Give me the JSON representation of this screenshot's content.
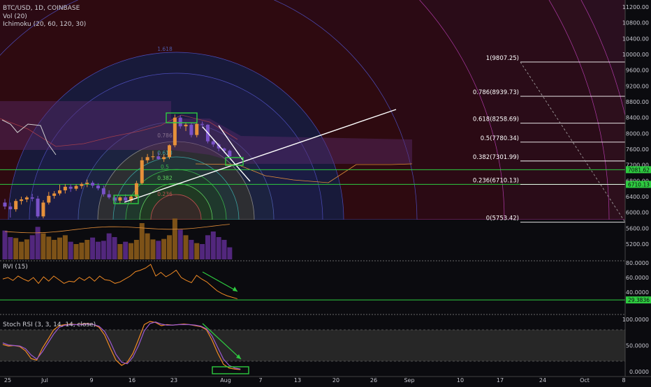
{
  "header": {
    "title": "BTC/USD, 1D, COINBASE",
    "vol_label": "Vol (20)",
    "ichimoku_label": "Ichimoku (20, 60, 120, 30)"
  },
  "panes": {
    "rvi_label": "RVI (15)",
    "stoch_label": "Stoch RSI (3, 3, 14, 14, close)"
  },
  "colors": {
    "background": "#0b0b0f",
    "bull_candle": "#e6903a",
    "bear_candle": "#7a52c8",
    "green_line": "#2ecc40",
    "white_line": "#ffffff",
    "rvi_line": "#f08a24",
    "stoch_k": "#f08a24",
    "stoch_d": "#9b59d0",
    "fib_fan_yellow": "#d7c84a",
    "fib_fan_outer": "#c94ccf"
  },
  "chart_data": [
    {
      "type": "candlestick",
      "title": "BTC/USD, 1D, COINBASE",
      "x_ticks": [
        "25",
        "Jul",
        "9",
        "16",
        "23",
        "Aug",
        "7",
        "13",
        "20",
        "26",
        "Sep",
        "10",
        "17",
        "24",
        "Oct",
        "8"
      ],
      "y_ticks": [
        "11200.00",
        "10800.00",
        "10400.00",
        "10000.00",
        "9600.00",
        "9200.00",
        "8800.00",
        "8400.00",
        "8000.00",
        "7600.00",
        "7200.00",
        "6800.00",
        "6400.00",
        "6000.00",
        "5600.00",
        "5200.00"
      ],
      "price_tags": [
        "7081.62",
        "6710.13"
      ],
      "candles": [
        {
          "o": 6250,
          "h": 6340,
          "l": 6080,
          "c": 6150
        },
        {
          "o": 6150,
          "h": 6250,
          "l": 5870,
          "c": 6080
        },
        {
          "o": 6080,
          "h": 6340,
          "l": 6020,
          "c": 6290
        },
        {
          "o": 6290,
          "h": 6400,
          "l": 6200,
          "c": 6330
        },
        {
          "o": 6330,
          "h": 6420,
          "l": 6260,
          "c": 6380
        },
        {
          "o": 6380,
          "h": 6470,
          "l": 6280,
          "c": 6350
        },
        {
          "o": 6350,
          "h": 6420,
          "l": 5860,
          "c": 5900
        },
        {
          "o": 5900,
          "h": 6310,
          "l": 5850,
          "c": 6250
        },
        {
          "o": 6250,
          "h": 6520,
          "l": 6200,
          "c": 6420
        },
        {
          "o": 6420,
          "h": 6540,
          "l": 6350,
          "c": 6480
        },
        {
          "o": 6480,
          "h": 6700,
          "l": 6430,
          "c": 6560
        },
        {
          "o": 6560,
          "h": 6720,
          "l": 6480,
          "c": 6650
        },
        {
          "o": 6650,
          "h": 6720,
          "l": 6520,
          "c": 6600
        },
        {
          "o": 6600,
          "h": 6710,
          "l": 6550,
          "c": 6670
        },
        {
          "o": 6670,
          "h": 6760,
          "l": 6600,
          "c": 6720
        },
        {
          "o": 6720,
          "h": 6830,
          "l": 6640,
          "c": 6750
        },
        {
          "o": 6750,
          "h": 6800,
          "l": 6620,
          "c": 6680
        },
        {
          "o": 6680,
          "h": 6740,
          "l": 6560,
          "c": 6610
        },
        {
          "o": 6610,
          "h": 6680,
          "l": 6400,
          "c": 6460
        },
        {
          "o": 6460,
          "h": 6560,
          "l": 6340,
          "c": 6380
        },
        {
          "o": 6380,
          "h": 6420,
          "l": 6250,
          "c": 6300
        },
        {
          "o": 6300,
          "h": 6410,
          "l": 6230,
          "c": 6380
        },
        {
          "o": 6380,
          "h": 6460,
          "l": 6250,
          "c": 6300
        },
        {
          "o": 6300,
          "h": 6450,
          "l": 6250,
          "c": 6400
        },
        {
          "o": 6400,
          "h": 6800,
          "l": 6350,
          "c": 6740
        },
        {
          "o": 6740,
          "h": 7400,
          "l": 6700,
          "c": 7320
        },
        {
          "o": 7320,
          "h": 7480,
          "l": 7250,
          "c": 7400
        },
        {
          "o": 7400,
          "h": 7560,
          "l": 7330,
          "c": 7420
        },
        {
          "o": 7420,
          "h": 7520,
          "l": 7330,
          "c": 7350
        },
        {
          "o": 7350,
          "h": 7470,
          "l": 7280,
          "c": 7400
        },
        {
          "o": 7400,
          "h": 7720,
          "l": 7350,
          "c": 7700
        },
        {
          "o": 7700,
          "h": 8480,
          "l": 7650,
          "c": 8400
        },
        {
          "o": 8400,
          "h": 8460,
          "l": 8120,
          "c": 8180
        },
        {
          "o": 8180,
          "h": 8280,
          "l": 8060,
          "c": 8220
        },
        {
          "o": 8220,
          "h": 8260,
          "l": 7900,
          "c": 7960
        },
        {
          "o": 7960,
          "h": 8290,
          "l": 7900,
          "c": 8240
        },
        {
          "o": 8240,
          "h": 8300,
          "l": 8130,
          "c": 8220
        },
        {
          "o": 8220,
          "h": 8230,
          "l": 7750,
          "c": 7800
        },
        {
          "o": 7800,
          "h": 7850,
          "l": 7660,
          "c": 7720
        },
        {
          "o": 7720,
          "h": 7760,
          "l": 7550,
          "c": 7620
        },
        {
          "o": 7620,
          "h": 7640,
          "l": 7500,
          "c": 7560
        },
        {
          "o": 7560,
          "h": 7590,
          "l": 7380,
          "c": 7420
        }
      ],
      "volume": [
        620,
        480,
        460,
        380,
        430,
        520,
        700,
        560,
        490,
        420,
        470,
        520,
        380,
        330,
        360,
        420,
        470,
        380,
        400,
        560,
        480,
        330,
        380,
        350,
        420,
        780,
        560,
        430,
        400,
        440,
        520,
        880,
        640,
        520,
        420,
        350,
        330,
        520,
        600,
        480,
        420,
        260
      ]
    },
    {
      "type": "line",
      "title": "RVI (15)",
      "y_ticks": [
        "80.0000",
        "60.0000",
        "40.0000"
      ],
      "level_tag": "29.3836",
      "values": [
        58,
        60,
        56,
        62,
        58,
        55,
        60,
        52,
        61,
        55,
        62,
        57,
        52,
        55,
        54,
        60,
        56,
        61,
        55,
        62,
        57,
        56,
        52,
        54,
        58,
        62,
        68,
        70,
        73,
        78,
        62,
        67,
        61,
        65,
        70,
        60,
        56,
        53,
        63,
        58,
        54,
        48,
        42,
        38,
        35,
        33,
        31
      ]
    },
    {
      "type": "line",
      "title": "Stoch RSI (3, 3, 14, 14, close)",
      "y_ticks": [
        "100.0000",
        "50.0000",
        "0.0000"
      ],
      "series": [
        {
          "values": [
            52,
            49,
            50,
            48,
            40,
            25,
            22,
            45,
            62,
            80,
            88,
            90,
            91,
            90,
            91,
            92,
            90,
            85,
            70,
            45,
            22,
            12,
            18,
            35,
            62,
            90,
            96,
            94,
            88,
            90,
            89,
            90,
            91,
            90,
            88,
            86,
            80,
            60,
            35,
            14,
            7,
            5,
            4
          ]
        },
        {
          "values": [
            55,
            51,
            50,
            49,
            44,
            32,
            24,
            38,
            55,
            72,
            85,
            89,
            90,
            90,
            90,
            91,
            90,
            87,
            77,
            57,
            33,
            18,
            15,
            28,
            50,
            78,
            92,
            95,
            91,
            89,
            89,
            90,
            90,
            90,
            89,
            87,
            82,
            68,
            46,
            24,
            12,
            7,
            5
          ]
        }
      ]
    },
    {
      "type": "fibonacci",
      "levels": [
        {
          "ratio": "1",
          "price": "9807.25",
          "label": "1(9807.25)"
        },
        {
          "ratio": "0.786",
          "price": "8939.73",
          "label": "0.786(8939.73)"
        },
        {
          "ratio": "0.618",
          "price": "8258.69",
          "label": "0.618(8258.69)"
        },
        {
          "ratio": "0.5",
          "price": "7780.34",
          "label": "0.5(7780.34)"
        },
        {
          "ratio": "0.382",
          "price": "7301.99",
          "label": "0.382(7301.99)"
        },
        {
          "ratio": "0.236",
          "price": "6710.13",
          "label": "0.236(6710.13)"
        },
        {
          "ratio": "0",
          "price": "5753.42",
          "label": "0(5753.42)"
        }
      ],
      "arc_labels": [
        "1.618",
        "0.786",
        "0.618",
        "0.5",
        "0.382",
        "0.236"
      ]
    }
  ]
}
